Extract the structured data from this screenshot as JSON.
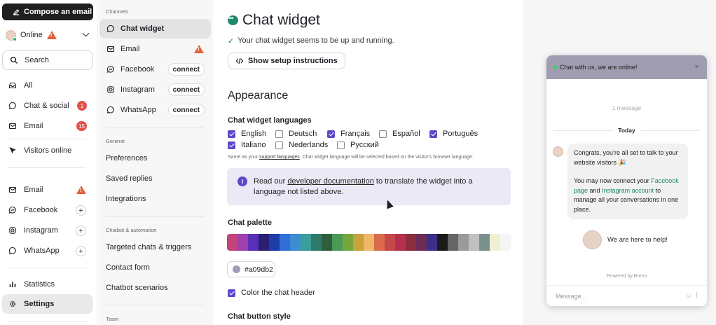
{
  "nav": {
    "compose_label": "Compose an email",
    "status_label": "Online",
    "search_label": "Search",
    "items": [
      {
        "label": "All"
      },
      {
        "label": "Chat & social",
        "badge": "1"
      },
      {
        "label": "Email",
        "badge": "15"
      },
      {
        "label": "Visitors online"
      }
    ],
    "channels": [
      {
        "label": "Email"
      },
      {
        "label": "Facebook",
        "action": "+"
      },
      {
        "label": "Instagram",
        "action": "+"
      },
      {
        "label": "WhatsApp",
        "action": "+"
      }
    ],
    "bottom": [
      {
        "label": "Statistics"
      },
      {
        "label": "Settings"
      }
    ]
  },
  "settings_menu": {
    "channels_heading": "Channels",
    "channels": [
      {
        "label": "Chat widget"
      },
      {
        "label": "Email"
      },
      {
        "label": "Facebook",
        "action": "connect"
      },
      {
        "label": "Instagram",
        "action": "connect"
      },
      {
        "label": "WhatsApp",
        "action": "connect"
      }
    ],
    "general_heading": "General",
    "general": [
      "Preferences",
      "Saved replies",
      "Integrations"
    ],
    "chatbot_heading": "Chatbot & automation",
    "chatbot": [
      "Targeted chats & triggers",
      "Contact form",
      "Chatbot scenarios"
    ],
    "team_heading": "Team"
  },
  "main": {
    "title": "Chat widget",
    "running_text": "Your chat widget seems to be up and running.",
    "setup_button": "Show setup instructions",
    "appearance_heading": "Appearance",
    "languages_label": "Chat widget languages",
    "languages": [
      {
        "label": "English",
        "checked": true
      },
      {
        "label": "Deutsch",
        "checked": false
      },
      {
        "label": "Français",
        "checked": true
      },
      {
        "label": "Español",
        "checked": false
      },
      {
        "label": "Português",
        "checked": true
      },
      {
        "label": "Italiano",
        "checked": true
      },
      {
        "label": "Nederlands",
        "checked": false
      },
      {
        "label": "Русский",
        "checked": false
      }
    ],
    "languages_note_pre": "Same as your",
    "languages_note_link": "support languages",
    "languages_note_post": ". Chat widget language will be selected based on the visitor's browser language.",
    "info_pre": "Read our",
    "info_link": "developer documentation",
    "info_post": "to translate the widget into a language not listed above.",
    "palette_label": "Chat palette",
    "palette": [
      "#c2447a",
      "#9f3fb0",
      "#5a2fb8",
      "#2a1f73",
      "#1e3da8",
      "#2f6fd6",
      "#3d8bd1",
      "#3a9e9a",
      "#2f7a6b",
      "#2f5e3f",
      "#4a9a56",
      "#74a83e",
      "#c8a23a",
      "#f0b768",
      "#d96b4a",
      "#c44848",
      "#b5304f",
      "#8b2d3c",
      "#6b2d55",
      "#3a2f8a",
      "#1b1b1b",
      "#666666",
      "#9a9a9a",
      "#c0c0c0",
      "#7a908c",
      "#f1efd2",
      "#f5f5f5"
    ],
    "hex_value": "#a09db2",
    "color_header_label": "Color the chat header",
    "button_style_label": "Chat button style"
  },
  "widget": {
    "header_text": "Chat with us, we are online!",
    "close": "×",
    "message_count": "1 message",
    "day_label": "Today",
    "msg_line1": "Congrats, you’re all set to talk to your website visitors 🎉",
    "msg_pre": "You may now connect your",
    "msg_link1": "Facebook page",
    "msg_and": "and",
    "msg_link2": "Instagram account",
    "msg_post": "to manage all your conversations in one place.",
    "help_text": "We are here to help!",
    "powered": "Powered by Brevo",
    "input_placeholder": "Message..."
  }
}
